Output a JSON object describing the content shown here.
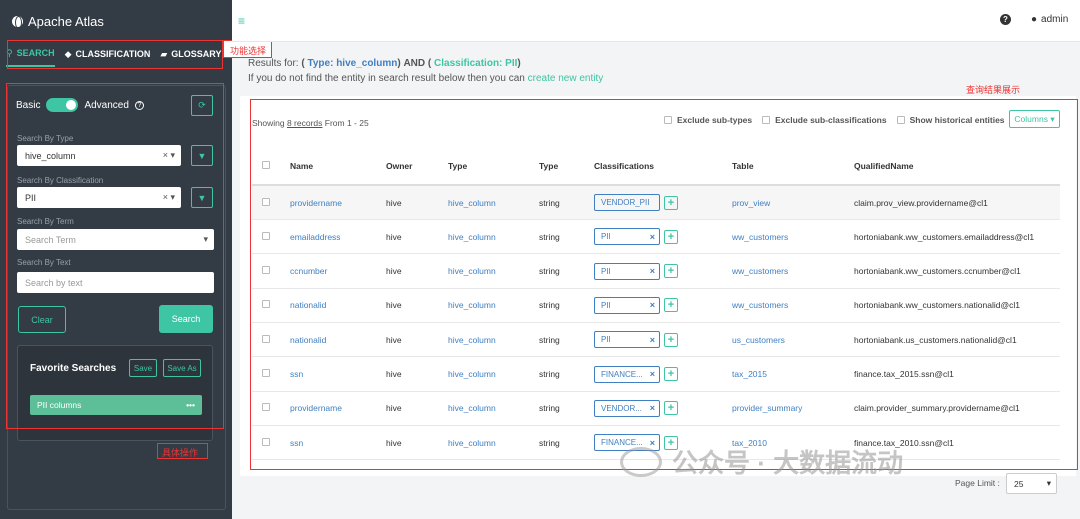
{
  "app": {
    "title": "Apache Atlas"
  },
  "topbar": {
    "user": "admin"
  },
  "sidebar": {
    "tabs": [
      {
        "label": "SEARCH"
      },
      {
        "label": "CLASSIFICATION"
      },
      {
        "label": "GLOSSARY"
      }
    ],
    "toggle": {
      "left": "Basic",
      "right": "Advanced"
    },
    "by_type": {
      "label": "Search By Type",
      "value": "hive_column"
    },
    "by_classification": {
      "label": "Search By Classification",
      "value": "PII"
    },
    "by_term": {
      "label": "Search By Term",
      "placeholder": "Search Term"
    },
    "by_text": {
      "label": "Search By Text",
      "placeholder": "Search by text"
    },
    "clear_label": "Clear",
    "search_label": "Search",
    "favorites": {
      "title": "Favorite Searches",
      "save_label": "Save",
      "save_as_label": "Save As",
      "items": [
        "PII columns"
      ]
    }
  },
  "annotations": {
    "tabs_note": "功能选择",
    "results_note": "查询结果展示",
    "panel_note": "具体操作"
  },
  "results": {
    "prefix": "Results for: ",
    "type_label": "Type: hive_column",
    "and": " AND ",
    "class_label": "Classification: PII",
    "hint": "If you do not find the entity in search result below then you can ",
    "hint_link": "create new entity",
    "showing_prefix": "Showing ",
    "records": "8 records",
    "range": " From 1 - 25",
    "opt_subtypes": "Exclude sub-types",
    "opt_subclass": "Exclude sub-classifications",
    "opt_history": "Show historical entities",
    "columns_btn": "Columns",
    "headers": [
      "Name",
      "Owner",
      "Type",
      "Type",
      "Classifications",
      "Table",
      "QualifiedName"
    ],
    "rows": [
      {
        "name": "providername",
        "owner": "hive",
        "type": "hive_column",
        "dtype": "string",
        "cls": "VENDOR_PII",
        "table": "prov_view",
        "qn": "claim.prov_view.providername@cl1"
      },
      {
        "name": "emailaddress",
        "owner": "hive",
        "type": "hive_column",
        "dtype": "string",
        "cls": "PII",
        "table": "ww_customers",
        "qn": "hortoniabank.ww_customers.emailaddress@cl1"
      },
      {
        "name": "ccnumber",
        "owner": "hive",
        "type": "hive_column",
        "dtype": "string",
        "cls": "PII",
        "table": "ww_customers",
        "qn": "hortoniabank.ww_customers.ccnumber@cl1"
      },
      {
        "name": "nationalid",
        "owner": "hive",
        "type": "hive_column",
        "dtype": "string",
        "cls": "PII",
        "table": "ww_customers",
        "qn": "hortoniabank.ww_customers.nationalid@cl1"
      },
      {
        "name": "nationalid",
        "owner": "hive",
        "type": "hive_column",
        "dtype": "string",
        "cls": "PII",
        "table": "us_customers",
        "qn": "hortoniabank.us_customers.nationalid@cl1"
      },
      {
        "name": "ssn",
        "owner": "hive",
        "type": "hive_column",
        "dtype": "string",
        "cls": "FINANCE...",
        "table": "tax_2015",
        "qn": "finance.tax_2015.ssn@cl1"
      },
      {
        "name": "providername",
        "owner": "hive",
        "type": "hive_column",
        "dtype": "string",
        "cls": "VENDOR...",
        "table": "provider_summary",
        "qn": "claim.provider_summary.providername@cl1"
      },
      {
        "name": "ssn",
        "owner": "hive",
        "type": "hive_column",
        "dtype": "string",
        "cls": "FINANCE...",
        "table": "tax_2010",
        "qn": "finance.tax_2010.ssn@cl1"
      }
    ],
    "page_limit_label": "Page Limit :",
    "page_limit_value": "25"
  },
  "watermark": "公众号 · 大数据流动"
}
